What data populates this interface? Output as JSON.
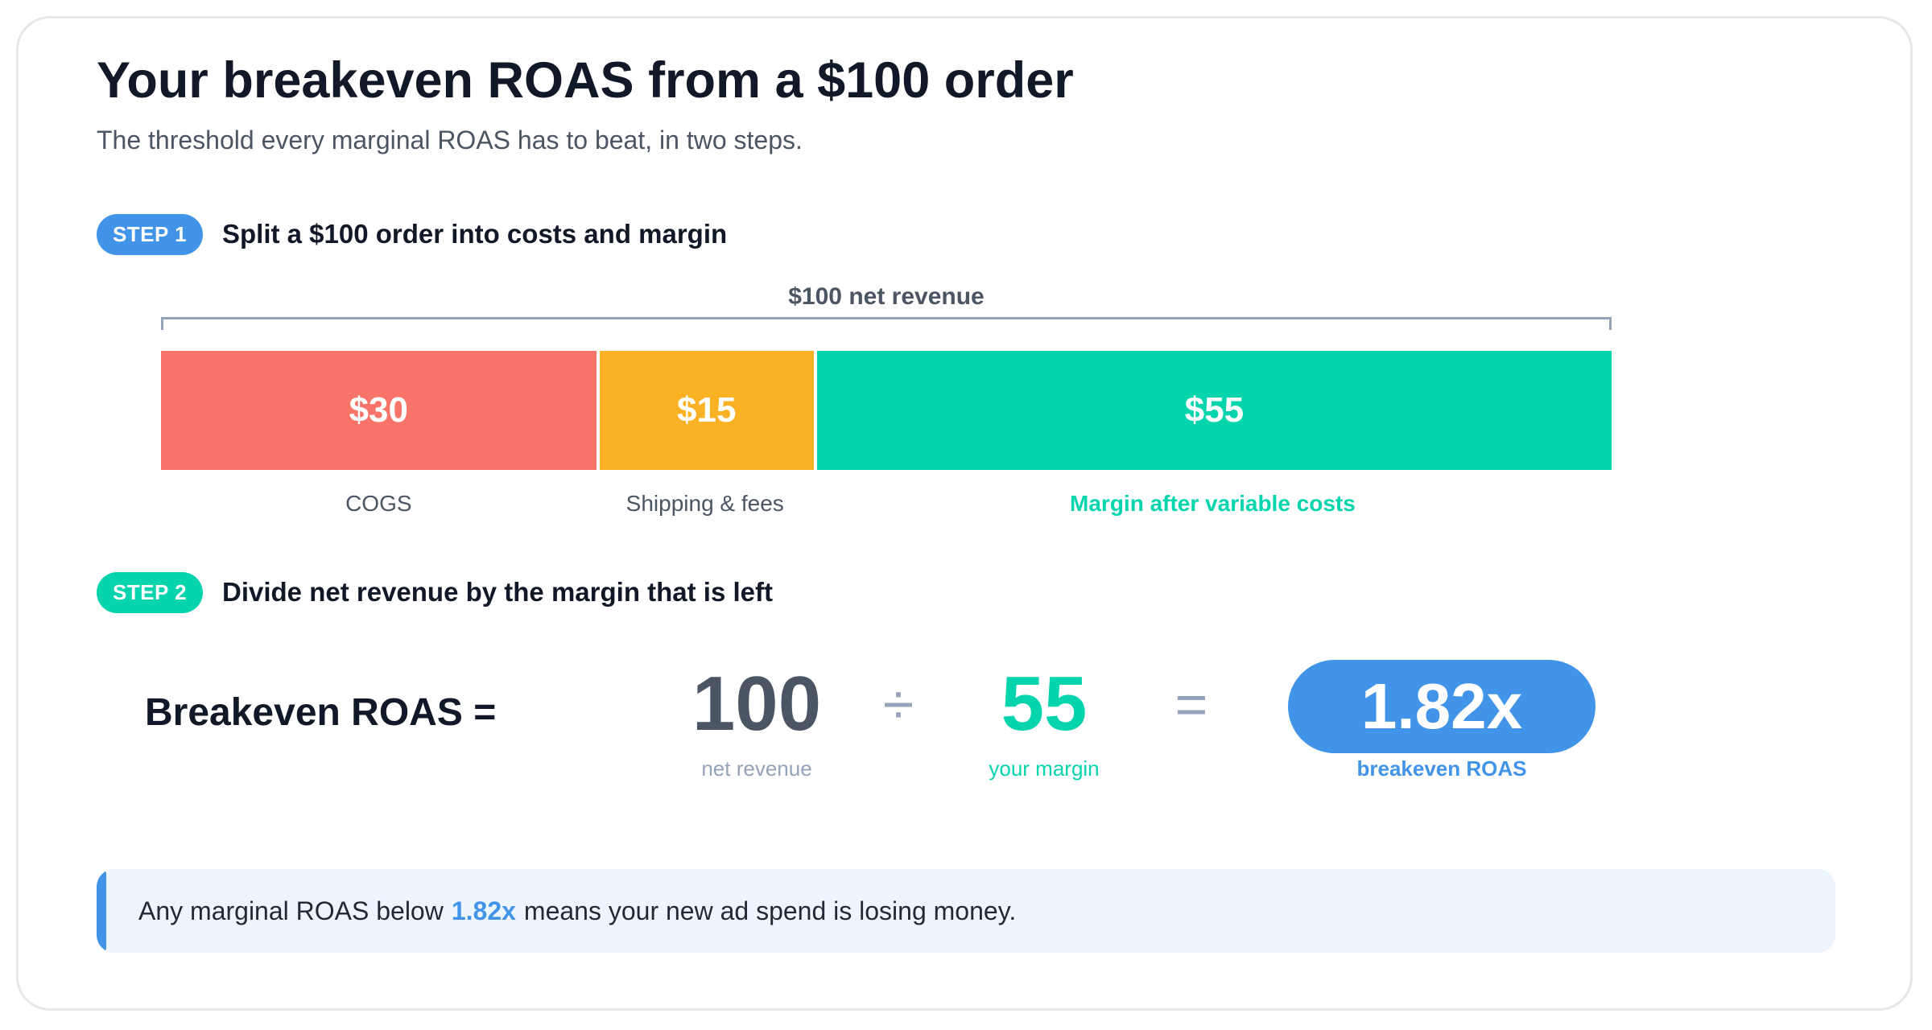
{
  "title": "Your breakeven ROAS from a $100 order",
  "subtitle": "The threshold every marginal ROAS has to beat, in two steps.",
  "colors": {
    "cogs": "#f87368",
    "shipping": "#fbb124",
    "margin": "#05d4ad",
    "accent_blue": "#4294e8",
    "muted": "#94a3b8"
  },
  "step1": {
    "badge": "STEP 1",
    "heading": "Split a $100 order into costs and margin",
    "brace_label": "$100 net revenue",
    "segments": [
      {
        "value_label": "$30",
        "amount": 30,
        "label": "COGS"
      },
      {
        "value_label": "$15",
        "amount": 15,
        "label": "Shipping & fees"
      },
      {
        "value_label": "$55",
        "amount": 55,
        "label": "Margin after variable costs"
      }
    ]
  },
  "step2": {
    "badge": "STEP 2",
    "heading": "Divide net revenue by the margin that is left",
    "equation_label": "Breakeven ROAS =",
    "numerator": "100",
    "numerator_caption": "net revenue",
    "divide_sign": "÷",
    "denominator": "55",
    "denominator_caption": "your margin",
    "equals_sign": "=",
    "result": "1.82x",
    "result_caption": "breakeven ROAS"
  },
  "callout": {
    "text_before": "Any marginal ROAS below",
    "highlight": "1.82x",
    "text_after": "means your new ad spend is losing money."
  }
}
